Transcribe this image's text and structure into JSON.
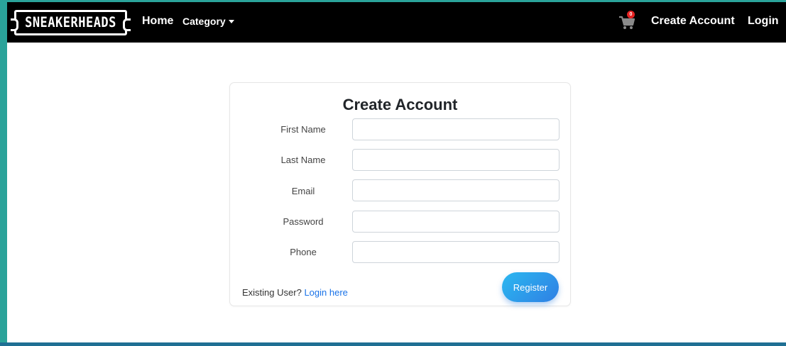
{
  "navbar": {
    "logo_text": "SNEAKERHEADS",
    "home_label": "Home",
    "category_label": "Category",
    "cart_count": "0",
    "create_account_label": "Create Account",
    "login_label": "Login"
  },
  "form": {
    "title": "Create Account",
    "fields": [
      {
        "label": "First Name",
        "value": "",
        "placeholder": ""
      },
      {
        "label": "Last Name",
        "value": "",
        "placeholder": ""
      },
      {
        "label": "Email",
        "value": "",
        "placeholder": ""
      },
      {
        "label": "Password",
        "value": "",
        "placeholder": ""
      },
      {
        "label": "Phone",
        "value": "",
        "placeholder": ""
      }
    ],
    "existing_user_text": "Existing User?",
    "login_link_text": "Login here",
    "register_label": "Register"
  },
  "colors": {
    "navbar": "#000000",
    "accent_teal": "#2aa39a",
    "register_gradient_start": "#2bb8f0",
    "register_gradient_end": "#2f7fe4",
    "link": "#1a73e8",
    "cart_badge": "#e52222"
  },
  "icons": {
    "cart": "shopping-cart-icon",
    "category_caret": "caret-down-icon"
  }
}
